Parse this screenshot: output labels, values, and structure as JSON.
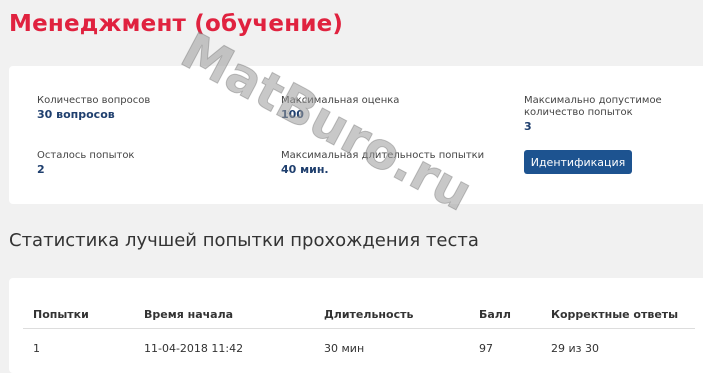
{
  "title": "Менеджмент (обучение)",
  "info": {
    "questions_label": "Количество вопросов",
    "questions_value": "30 вопросов",
    "max_score_label": "Максимальная оценка",
    "max_score_value": "100",
    "max_attempts_label": "Максимально допустимое количество попыток",
    "max_attempts_value": "3",
    "remaining_label": "Осталось попыток",
    "remaining_value": "2",
    "duration_label": "Максимальная длительность попытки",
    "duration_value": "40 мин.",
    "identify_button": "Идентификация"
  },
  "stats_title": "Статистика лучшей попытки прохождения теста",
  "table": {
    "headers": [
      "Попытки",
      "Время начала",
      "Длительность",
      "Балл",
      "Корректные ответы"
    ],
    "rows": [
      [
        "1",
        "11-04-2018 11:42",
        "30 мин",
        "97",
        "29 из 30"
      ]
    ]
  },
  "watermark": "MatBuro.ru",
  "colors": {
    "title": "#e0223f",
    "button": "#1d5390",
    "value": "#1f3f6e"
  }
}
